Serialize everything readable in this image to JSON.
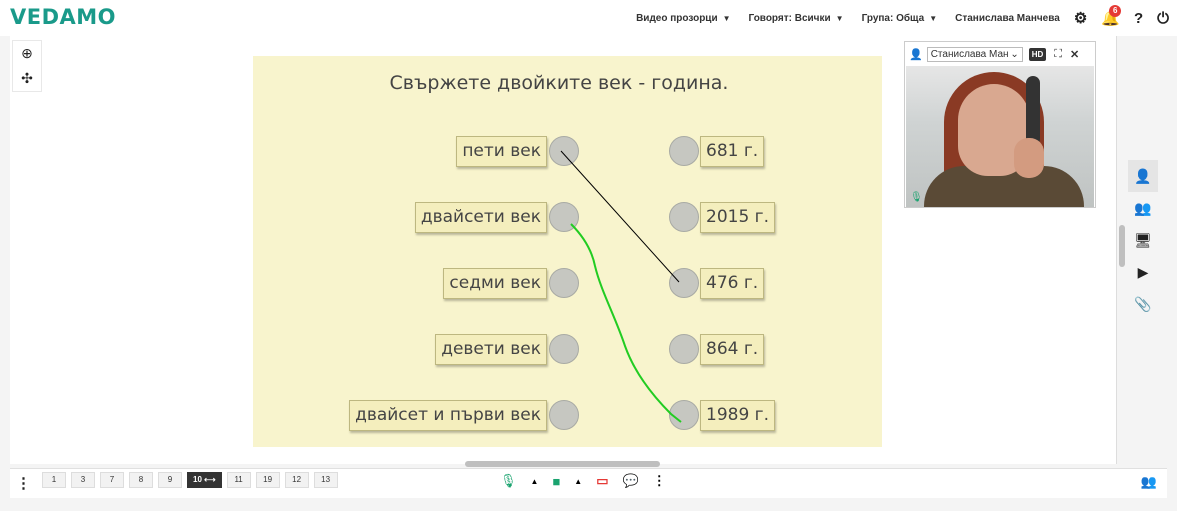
{
  "app": {
    "logo": "VEDAMO"
  },
  "top_menu": {
    "video_windows": "Видео прозорци",
    "speaking": "Говорят: Всички",
    "group": "Група: Обща",
    "user": "Станислава Манчева",
    "notifications_count": "6",
    "settings_glyph": "⚙",
    "bell_glyph": "🔔",
    "help_glyph": "?",
    "power_glyph": "⏻",
    "caret": "▼"
  },
  "tools": {
    "zoom_glyph": "⊕",
    "fit_glyph": "✣"
  },
  "exercise": {
    "title": "Свържете двойките век - година.",
    "left_items": [
      "пети век",
      "двайсети век",
      "седми век",
      "девети век",
      "двайсет и първи век"
    ],
    "right_items": [
      "681 г.",
      "2015 г.",
      "476 г.",
      "864 г.",
      "1989 г."
    ],
    "matches": [
      {
        "from": "пети век",
        "to": "476 г.",
        "color": "#000000"
      },
      {
        "from": "двайсети век",
        "to": "1989 г.",
        "color": "#22cc22"
      }
    ]
  },
  "video": {
    "participant": "Станислава Ман",
    "hd_label": "HD",
    "person_glyph": "👤",
    "dropdown_glyph": "⌄",
    "expand_glyph": "⛶",
    "close_glyph": "✕",
    "mic_glyph": "🎙"
  },
  "right_rail": {
    "glyphs": [
      "👤",
      "👥",
      "🖥",
      "▶",
      "📎"
    ]
  },
  "bottom": {
    "menu_glyph": "⋮",
    "pages": [
      "1",
      "3",
      "7",
      "8",
      "9",
      "10 ⟷",
      "11",
      "19",
      "12",
      "13"
    ],
    "active_page": "10 ⟷",
    "media_glyphs": [
      "🎙",
      "▲",
      "■",
      "▲",
      "▭",
      "💬",
      "⋮"
    ],
    "people_glyph": "👥"
  },
  "colors": {
    "brand": "#1a9a8a",
    "exercise_bg": "#f8f4cd",
    "card_bg": "#f4eebd",
    "mic": "#1aa36f",
    "camera": "#1aa36f",
    "screen": "#e53935",
    "badge": "#e53935"
  }
}
